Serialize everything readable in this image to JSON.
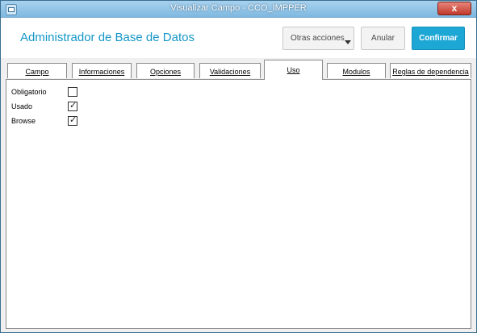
{
  "window": {
    "title": "Visualizar Campo - CCO_IMPPER",
    "close_glyph": "x"
  },
  "header": {
    "app_title": "Administrador de Base de Datos",
    "buttons": {
      "otras": "Otras acciones",
      "anular": "Anular",
      "confirmar": "Confirmar"
    },
    "accent_color": "#1da7d4"
  },
  "tabs": [
    {
      "label": "Campo",
      "active": false
    },
    {
      "label": "Informaciones",
      "active": false
    },
    {
      "label": "Opciones",
      "active": false
    },
    {
      "label": "Validaciones",
      "active": false
    },
    {
      "label": "Uso",
      "active": true
    },
    {
      "label": "Modulos",
      "active": false
    },
    {
      "label": "Reglas de dependencia",
      "active": false
    }
  ],
  "uso": {
    "fields": [
      {
        "label": "Obligatorio",
        "checked": false
      },
      {
        "label": "Usado",
        "checked": true
      },
      {
        "label": "Browse",
        "checked": true
      }
    ]
  }
}
